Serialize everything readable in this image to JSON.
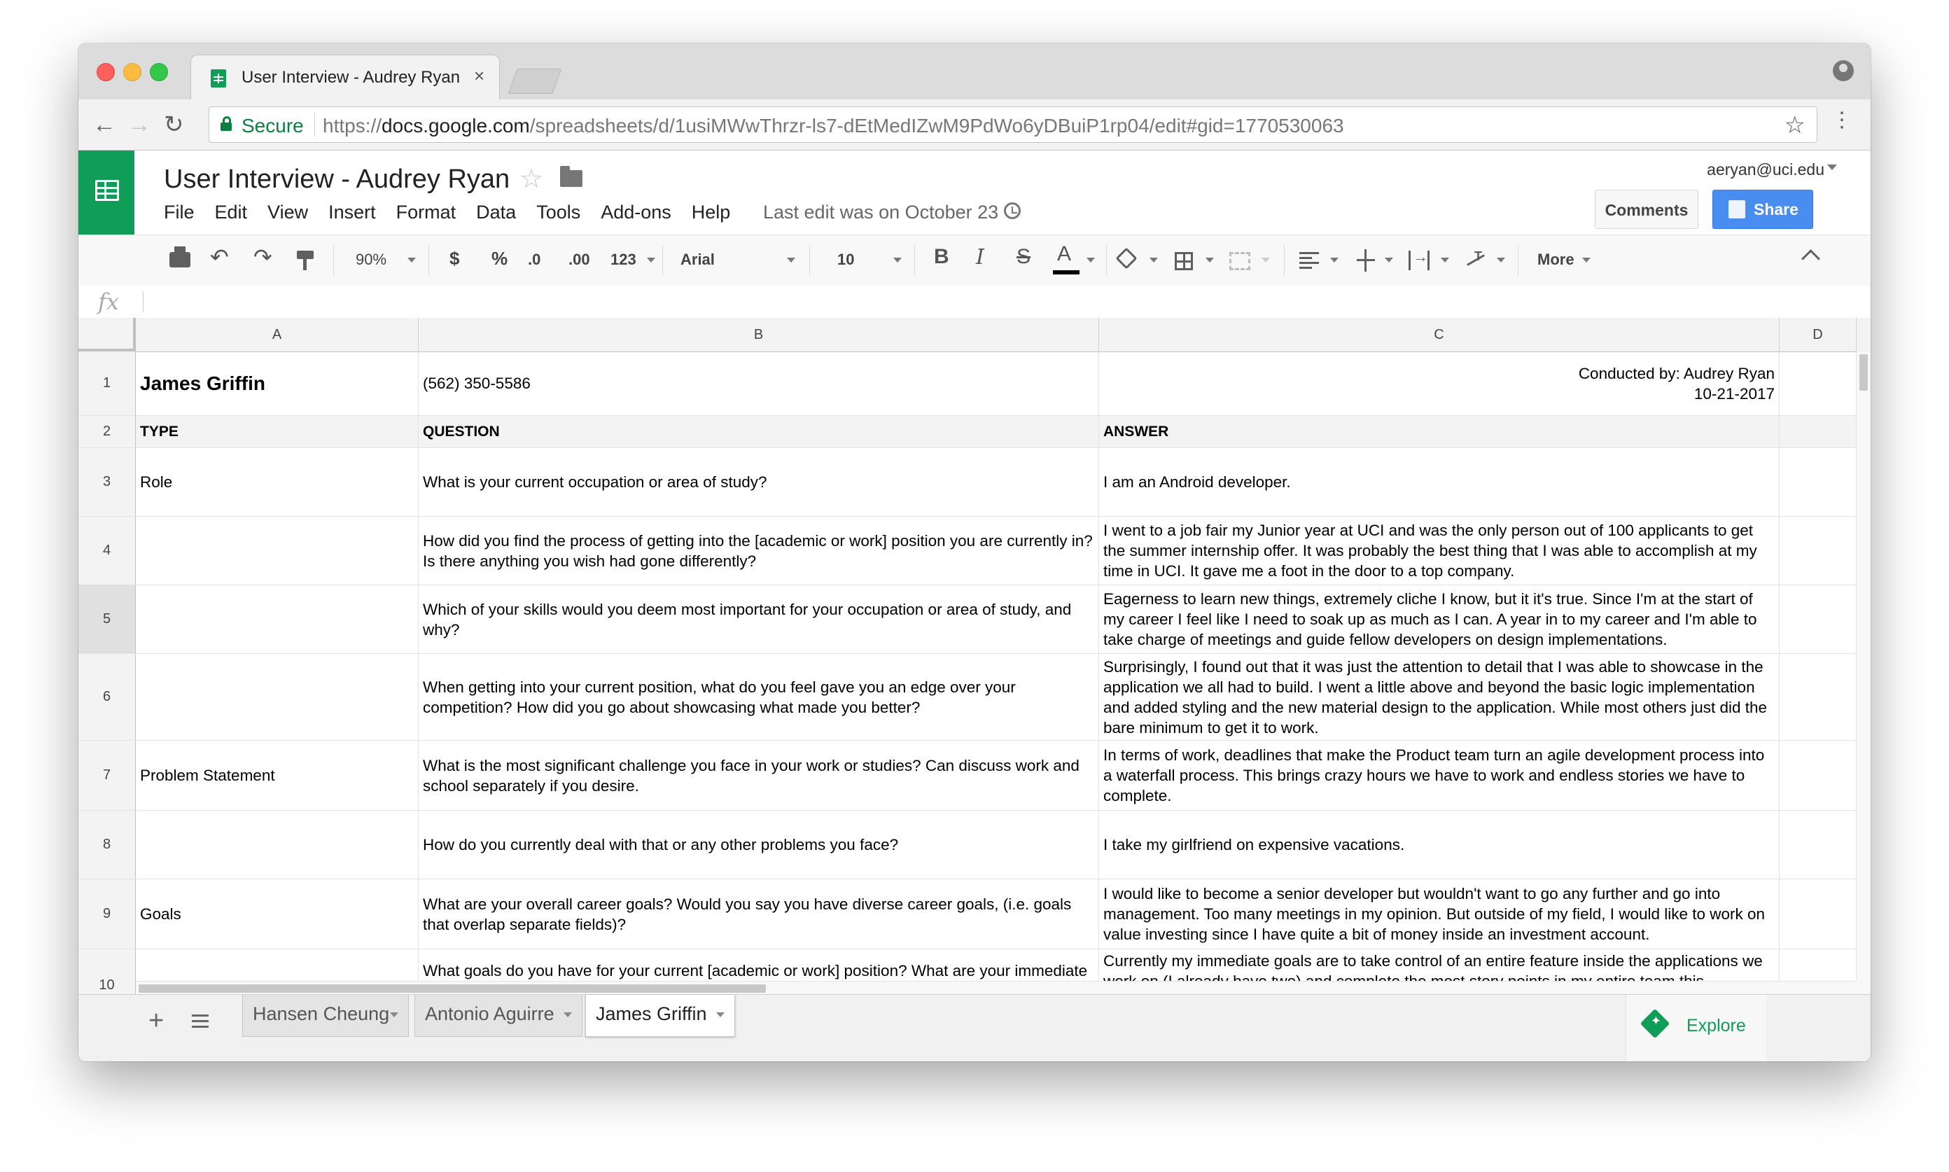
{
  "browser": {
    "tab_title": "User Interview - Audrey Ryan",
    "tab_close": "×",
    "secure_label": "Secure",
    "url_scheme": "https://",
    "url_host": "docs.google.com",
    "url_path": "/spreadsheets/d/1usiMWwThrzr-ls7-dEtMedIZwM9PdWo6yDBuiP1rp04/edit#gid=1770530063",
    "back": "←",
    "forward": "→",
    "reload": "↻",
    "bookmark": "☆",
    "menu": "⋮"
  },
  "doc": {
    "title": "User Interview - Audrey Ryan",
    "star": "☆",
    "menu": [
      "File",
      "Edit",
      "View",
      "Insert",
      "Format",
      "Data",
      "Tools",
      "Add-ons",
      "Help"
    ],
    "last_edit": "Last edit was on October 23",
    "user_email": "aeryan@uci.edu",
    "comments_label": "Comments",
    "share_label": "Share"
  },
  "toolbar": {
    "undo": "↶",
    "redo": "↷",
    "zoom": "90%",
    "currency": "$",
    "percent": "%",
    "dec_decrease": ".0",
    "dec_increase": ".00",
    "number_format": "123",
    "font": "Arial",
    "font_size": "10",
    "bold": "B",
    "italic": "I",
    "strike": "S",
    "text_color": "A",
    "more": "More"
  },
  "formula": {
    "fx": "fx"
  },
  "grid": {
    "columns": [
      "A",
      "B",
      "C",
      "D"
    ],
    "rows": [
      {
        "num": "1",
        "a": "James Griffin",
        "b": "(562) 350-5586",
        "c": "Conducted by: Audrey Ryan\n10-21-2017"
      },
      {
        "num": "2",
        "a": "TYPE",
        "b": "QUESTION",
        "c": "ANSWER"
      },
      {
        "num": "3",
        "a": "Role",
        "b": "What is your current occupation or area of study?",
        "c": "I am an Android developer."
      },
      {
        "num": "4",
        "a": "",
        "b": "How did you find the process of getting into the [academic or work] position you are currently in? Is there anything you wish had gone differently?",
        "c": "I went to a job fair my Junior year at UCI and was the only person out of 100 applicants to get the summer internship offer. It was probably the best thing that I was able to accomplish at my time in UCI. It gave me a foot in the door to a top company."
      },
      {
        "num": "5",
        "a": "",
        "b": "Which of your skills would you deem most important for your occupation or area of study, and why?",
        "c": "Eagerness to learn new things, extremely cliche I know, but it it's true. Since I'm at the start of my career I feel like I need to soak up as much as I can. A year in to my career and I'm able to take charge of meetings and guide fellow developers on design implementations."
      },
      {
        "num": "6",
        "a": "",
        "b": "When getting into your current position, what do you feel gave you an edge over your competition? How did you go about showcasing what made you better?",
        "c": "Surprisingly, I found out that it was just the attention to detail that I was able to showcase in the application we all had to build. I went a little above and beyond the basic logic implementation and added styling and the new material design to the application. While most others just did the bare minimum to get it to work."
      },
      {
        "num": "7",
        "a": "Problem Statement",
        "b": "What is the most significant challenge you face in your work or studies? Can discuss work and school separately if you desire.",
        "c": "In terms of work, deadlines that make the Product team turn an agile development process into a waterfall process. This brings crazy hours we have to work and endless stories we have to complete."
      },
      {
        "num": "8",
        "a": "",
        "b": "How do you currently deal with that or any other problems you face?",
        "c": "I take my girlfriend on expensive vacations."
      },
      {
        "num": "9",
        "a": "Goals",
        "b": "What are your overall career goals? Would you say you have diverse career goals, (i.e. goals that overlap separate fields)?",
        "c": "I would like to become a senior developer but wouldn't want to go any further and go into management. Too many meetings in my opinion. But outside of my field, I would like to work on value investing since I have quite a bit of money inside an investment account."
      },
      {
        "num": "10",
        "a": "",
        "b": "What goals do you have for your current [academic or work] position? What are your immediate goals?",
        "c": "Currently my immediate goals are to take control of an entire feature inside the applications we work on (I already have two) and complete the most story points in my entire team this"
      }
    ]
  },
  "sheets": {
    "add": "+",
    "tabs": [
      "Hansen Cheung",
      "Antonio Aguirre",
      "James Griffin"
    ],
    "active": "James Griffin",
    "explore_label": "Explore"
  },
  "colors": {
    "sheets_green": "#0f9d58",
    "share_blue": "#4a8df0",
    "secure_green": "#0b8043"
  }
}
